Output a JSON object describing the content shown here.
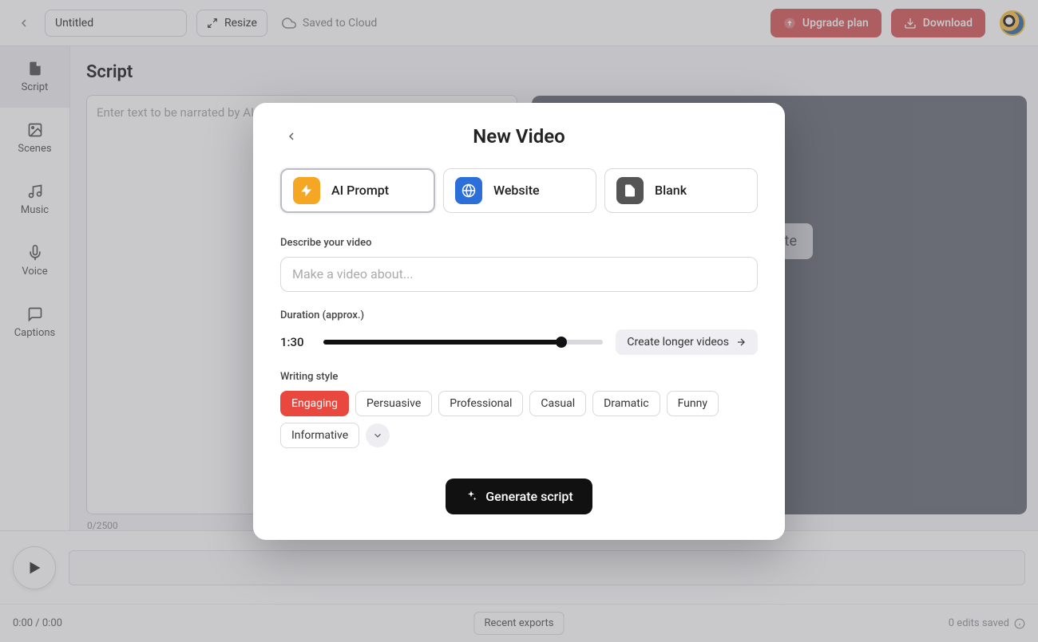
{
  "topbar": {
    "title_value": "Untitled",
    "resize_label": "Resize",
    "saved_label": "Saved to Cloud",
    "upgrade_label": "Upgrade plan",
    "download_label": "Download"
  },
  "nav": {
    "items": [
      {
        "label": "Script"
      },
      {
        "label": "Scenes"
      },
      {
        "label": "Music"
      },
      {
        "label": "Voice"
      },
      {
        "label": "Captions"
      }
    ]
  },
  "main": {
    "page_title": "Script",
    "textarea_placeholder": "Enter text to be narrated by AI.",
    "counter": "0/2500",
    "generate_label": "erate"
  },
  "player": {
    "time": "0:00 / 0:00"
  },
  "statusbar": {
    "recent_exports": "Recent exports",
    "edits_saved": "0 edits saved"
  },
  "modal": {
    "title": "New Video",
    "options": [
      {
        "label": "AI Prompt"
      },
      {
        "label": "Website"
      },
      {
        "label": "Blank"
      }
    ],
    "describe_label": "Describe your video",
    "prompt_placeholder": "Make a video about...",
    "duration_label": "Duration (approx.)",
    "duration_value": "1:30",
    "longer_label": "Create longer videos",
    "style_label": "Writing style",
    "styles": [
      {
        "label": "Engaging"
      },
      {
        "label": "Persuasive"
      },
      {
        "label": "Professional"
      },
      {
        "label": "Casual"
      },
      {
        "label": "Dramatic"
      },
      {
        "label": "Funny"
      },
      {
        "label": "Informative"
      }
    ],
    "generate_label": "Generate script"
  }
}
